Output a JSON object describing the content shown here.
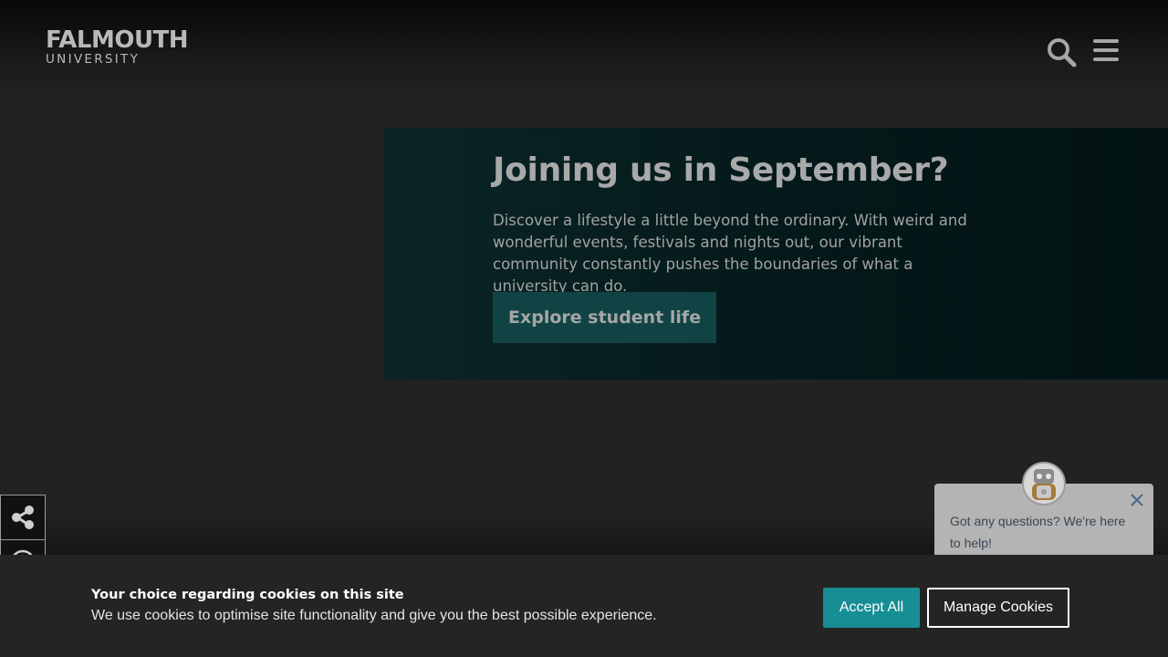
{
  "header": {
    "logo_main": "FALMOUTH",
    "logo_sub": "UNIVERSITY",
    "search_icon": "search-icon",
    "menu_icon": "hamburger-menu-icon"
  },
  "hero": {
    "title": "Joining us in September?",
    "text": "Discover a lifestyle a little beyond the ordinary. With weird and wonderful events, festivals and nights out, our vibrant community constantly pushes the boundaries of what a university can do.",
    "button_label": "Explore student life"
  },
  "side_tools": {
    "share_icon": "share-icon",
    "accessibility_icon": "accessibility-icon"
  },
  "chat": {
    "message": "Got any questions? We're here to help!",
    "avatar_icon": "robot-avatar-icon",
    "close_icon": "close-icon"
  },
  "cookie_banner": {
    "title": "Your choice regarding cookies on this site",
    "text": "We use cookies to optimise site functionality and give you the best possible experience.",
    "accept_label": "Accept All",
    "manage_label": "Manage Cookies"
  },
  "colors": {
    "background": "#222222",
    "hero_bg": "#051a1b",
    "hero_button": "#114344",
    "accept_button": "#178e93",
    "cookie_bg": "#242424"
  }
}
